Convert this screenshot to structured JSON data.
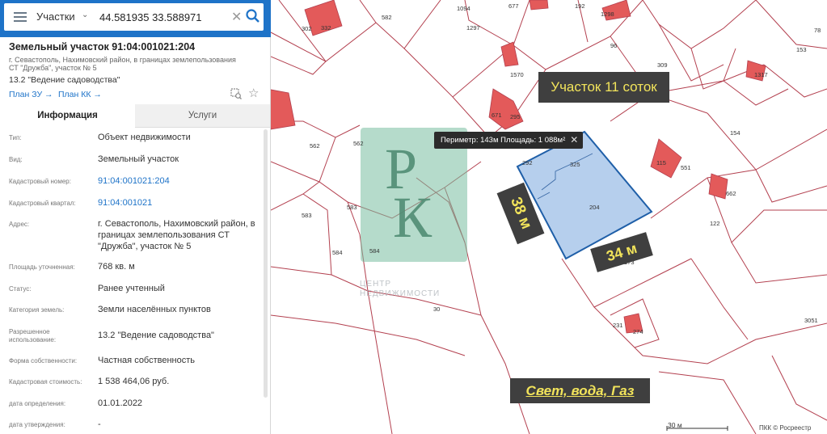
{
  "search": {
    "type_label": "Участки",
    "query": "44.581935 33.588971"
  },
  "parcel": {
    "title": "Земельный участок 91:04:001021:204",
    "address_short": "г. Севастополь, Нахимовский район, в границах землепользования СТ \"Дружба\", участок № 5",
    "use": "13.2 \"Ведение садоводства\"",
    "links": {
      "plan_zu": "План ЗУ",
      "plan_kk": "План КК",
      "arrow": "→"
    }
  },
  "tabs": {
    "info": "Информация",
    "services": "Услуги"
  },
  "rows": [
    {
      "label": "Тип:",
      "value": "Объект недвижимости",
      "link": false
    },
    {
      "label": "Вид:",
      "value": "Земельный участок",
      "link": false
    },
    {
      "label": "Кадастровый номер:",
      "value": "91:04:001021:204",
      "link": true
    },
    {
      "label": "Кадастровый квартал:",
      "value": "91:04:001021",
      "link": true
    },
    {
      "label": "Адрес:",
      "value": "г. Севастополь, Нахимовский район, в границах землепользования СТ \"Дружба\", участок № 5",
      "link": false
    },
    {
      "label": "Площадь уточненная:",
      "value": "768 кв. м",
      "link": false
    },
    {
      "label": "Статус:",
      "value": "Ранее учтенный",
      "link": false
    },
    {
      "label": "Категория земель:",
      "value": "Земли населённых пунктов",
      "link": false
    },
    {
      "label": "Разрешенное использование:",
      "value": "13.2 \"Ведение садоводства\"",
      "link": false
    },
    {
      "label": "Форма собственности:",
      "value": "Частная собственность",
      "link": false
    },
    {
      "label": "Кадастровая стоимость:",
      "value": "1 538 464,06 руб.",
      "link": false
    },
    {
      "label": "дата определения:",
      "value": "01.01.2022",
      "link": false
    },
    {
      "label": "дата утверждения:",
      "value": "-",
      "link": false
    }
  ],
  "map": {
    "area_label": "Участок 11 соток",
    "measure_tip": "Периметр: 143м Площадь: 1 088м²",
    "side_a": "38 м",
    "side_b": "34 м",
    "utilities": "Свет, вода, Газ",
    "scale": "30 м",
    "copyright": "ПКК © Росреестр",
    "watermark_text": "ЦЕНТР НЕДВИЖИМОСТИ",
    "watermark_letters": [
      "Р",
      "К"
    ],
    "lot_numbers": [
      "302",
      "332",
      "1297",
      "582",
      "1094",
      "677",
      "192",
      "1298",
      "78",
      "153",
      "96",
      "309",
      "1317",
      "671",
      "295",
      "292",
      "1570",
      "562",
      "562",
      "115",
      "551",
      "325",
      "204",
      "154",
      "122",
      "662",
      "583",
      "583",
      "584",
      "584",
      "30",
      "173",
      "231",
      "274",
      "3051"
    ],
    "colors": {
      "boundary": "#b3404f",
      "selected_fill": "#a9c7ea",
      "selected_stroke": "#1f5fa8",
      "building": "#e35a5a",
      "accent": "#1e73c8"
    }
  }
}
